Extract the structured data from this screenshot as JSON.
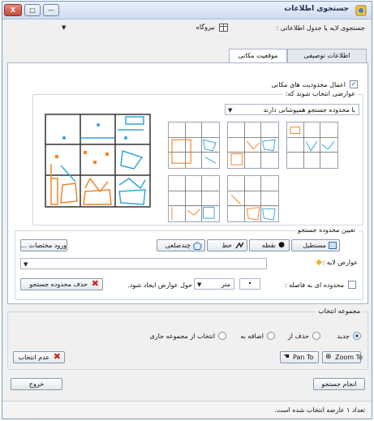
{
  "window": {
    "title": "جستجوی اطلاعات",
    "buttons": {
      "close": "X",
      "maximize": "□",
      "minimize": "—"
    }
  },
  "search_layer": {
    "label": "جستجوی لایه یا جدول اطلاعاتی :",
    "value": "نیروگاه"
  },
  "tabs": [
    {
      "label": "اطلاعات توصیفی",
      "active": false
    },
    {
      "label": "موقعیت مکانی",
      "active": true
    }
  ],
  "spatial": {
    "apply_constraints_label": "اعمال محدودیت های مکانی",
    "apply_constraints_checked": true,
    "features_selected_label": "عوارضی انتخاب شوند که:",
    "relation_value": "با محدوده جستجو همپوشانی دارند",
    "search_area_label": "تعیین محدوده جستجو",
    "shape_buttons": {
      "rectangle": "مستطیل",
      "point": "نقطه",
      "line": "خط",
      "polygon": "چندضلعی"
    },
    "enter_coords_button": "ورود مختصات ...",
    "layer_features_label": "عوارض لایه :",
    "buffer_checkbox_label": "محدوده ای به فاصله :",
    "buffer_value": "•",
    "buffer_unit": "متر",
    "buffer_suffix": "حول عوارض ایجاد شود.",
    "delete_area_button": "حذف محدوده جستجو"
  },
  "selection_set": {
    "label": "مجموعه انتخاب",
    "options": [
      {
        "label": "جدید",
        "selected": true
      },
      {
        "label": "حذف از",
        "selected": false
      },
      {
        "label": "اضافه به",
        "selected": false
      },
      {
        "label": "انتخاب از مجموعه جاری",
        "selected": false
      }
    ],
    "pan_to": "Pan To",
    "zoom_to": "Zoom To",
    "deselect": "عدم انتخاب"
  },
  "actions": {
    "run_search": "انجام جستجو",
    "exit": "خروج"
  },
  "status": {
    "text": "تعداد ۱ عارضه انتخاب شده است."
  },
  "colors": {
    "accent_blue": "#35a6d8",
    "accent_orange": "#f0862a",
    "grid_line": "#333333"
  },
  "icons": [
    "app-icon",
    "layer-table-icon",
    "rectangle-icon",
    "point-icon",
    "line-icon",
    "polygon-icon",
    "diamond-icon",
    "delete-x-icon",
    "pan-hand-icon",
    "zoom-magnifier-icon",
    "close-icon"
  ]
}
